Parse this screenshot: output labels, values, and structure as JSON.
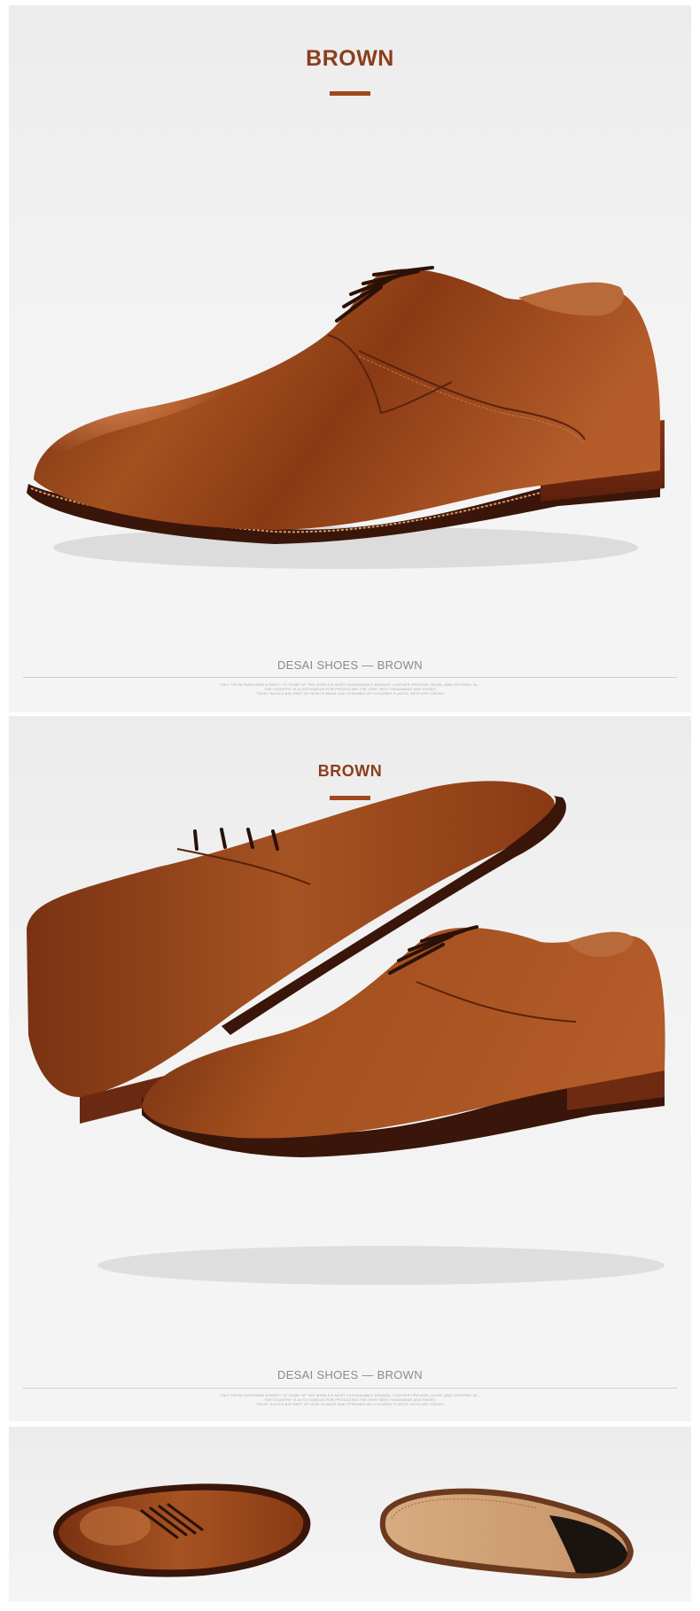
{
  "panels": [
    {
      "title": "BROWN",
      "caption": "DESAI SHOES — BROWN",
      "fine_print": [
        "ITALY FROM PURCHASE A PARTY TO SOME OF THE WORLD'S MOST FASHIONABLE BRANDS, LEATHER PROVIDE, GOOD, AND OFFERED IN...",
        "THE COUNTRY IS ALSO FAMOUS FOR PRODUCING THE VERY BEST HANDMADE AND SHOES",
        "TRUST SUCH A BIG PART OF HOW IS MADE AND STRAINED BY COLORED PLASTIC WITH DRY CRUSH"
      ]
    },
    {
      "title": "BROWN",
      "caption": "DESAI SHOES — BROWN",
      "fine_print": [
        "ITALY FROM PURCHASE A PARTY TO SOME OF THE WORLD'S MOST FASHIONABLE BRANDS, LEATHER PROVIDE, GOOD, AND OFFERED IN...",
        "THE COUNTRY IS ALSO FAMOUS FOR PRODUCING THE VERY BEST HANDMADE AND SHOES",
        "TRUST SUCH A BIG PART OF HOW IS MADE AND STRAINED BY COLORED PLASTIC WITH DRY CRUSH"
      ]
    }
  ],
  "colors": {
    "accent": "#a3471d",
    "title": "#8b3e1b",
    "leather": "#8a3a14",
    "leather_highlight": "#c06a3a",
    "sole": "#6e2a12",
    "outsole": "#d2a478"
  },
  "images": {
    "panel1": "brown-derby-shoe-side-view",
    "panel2": "pair-of-brown-derby-shoes",
    "panel3_left": "shoe-top-view",
    "panel3_right": "leather-outsole-view"
  }
}
